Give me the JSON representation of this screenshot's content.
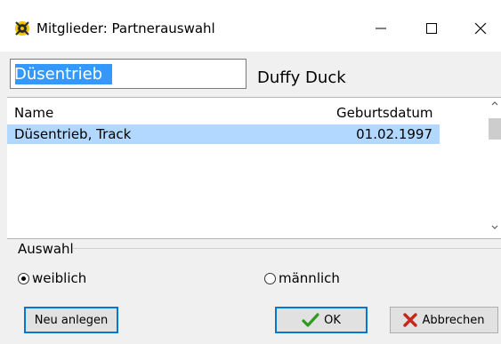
{
  "window": {
    "title": "Mitglieder: Partnerauswahl",
    "controls": {
      "minimize": "—",
      "maximize": "☐",
      "close": "✕"
    }
  },
  "search": {
    "value": "Düsentrieb"
  },
  "selected_partner": "Duffy Duck",
  "list": {
    "columns": [
      "Name",
      "Geburtsdatum"
    ],
    "rows": [
      {
        "name": "Düsentrieb, Track",
        "birthdate": "01.02.1997",
        "selected": true
      }
    ],
    "selection_color": "#b3d8ff"
  },
  "gender_group": {
    "label": "Auswahl",
    "options": [
      {
        "label": "weiblich",
        "checked": true
      },
      {
        "label": "männlich",
        "checked": false
      }
    ]
  },
  "buttons": {
    "new": "Neu anlegen",
    "ok": "OK",
    "cancel": "Abbrechen"
  },
  "colors": {
    "accent": "#0078d7",
    "highlight": "#3399ff",
    "ok_icon": "#2e9b1e",
    "cancel_icon": "#c4281c"
  }
}
